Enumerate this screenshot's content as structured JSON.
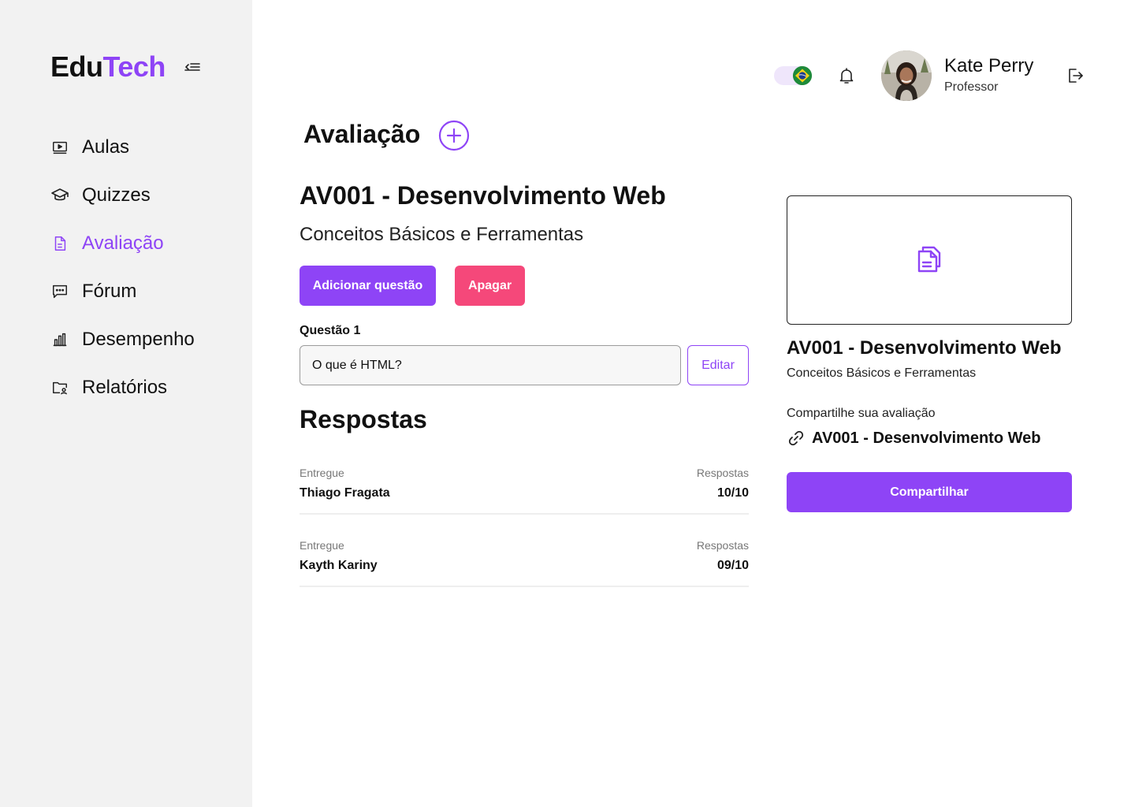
{
  "brand": {
    "part1": "Edu",
    "part2": "Tech"
  },
  "sidebar": {
    "items": [
      {
        "label": "Aulas",
        "icon": "video-lesson-icon"
      },
      {
        "label": "Quizzes",
        "icon": "graduation-cap-icon"
      },
      {
        "label": "Avaliação",
        "icon": "document-icon",
        "active": true
      },
      {
        "label": "Fórum",
        "icon": "chat-icon"
      },
      {
        "label": "Desempenho",
        "icon": "bar-chart-icon"
      },
      {
        "label": "Relatórios",
        "icon": "folder-user-icon"
      }
    ]
  },
  "header": {
    "language_flag": "brazil-flag-icon",
    "user_name": "Kate Perry",
    "user_role": "Professor"
  },
  "page": {
    "title": "Avaliação"
  },
  "evaluation": {
    "title": "AV001 - Desenvolvimento Web",
    "subtitle": "Conceitos Básicos e Ferramentas",
    "add_question_label": "Adicionar questão",
    "delete_label": "Apagar",
    "question_label": "Questão 1",
    "question_value": "O que é HTML?",
    "edit_label": "Editar"
  },
  "responses": {
    "title": "Respostas",
    "rows": [
      {
        "status": "Entregue",
        "name": "Thiago Fragata",
        "answers_label": "Respostas",
        "score": "10/10"
      },
      {
        "status": "Entregue",
        "name": "Kayth Kariny",
        "answers_label": "Respostas",
        "score": "09/10"
      }
    ]
  },
  "share_card": {
    "title": "AV001 - Desenvolvimento Web",
    "subtitle": "Conceitos Básicos e Ferramentas",
    "share_prompt": "Compartilhe sua avaliação",
    "link_text": "AV001 - Desenvolvimento Web",
    "share_button": "Compartilhar"
  },
  "colors": {
    "accent": "#8e44f6",
    "danger": "#f5487a",
    "sidebar_bg": "#f2f2f2"
  }
}
